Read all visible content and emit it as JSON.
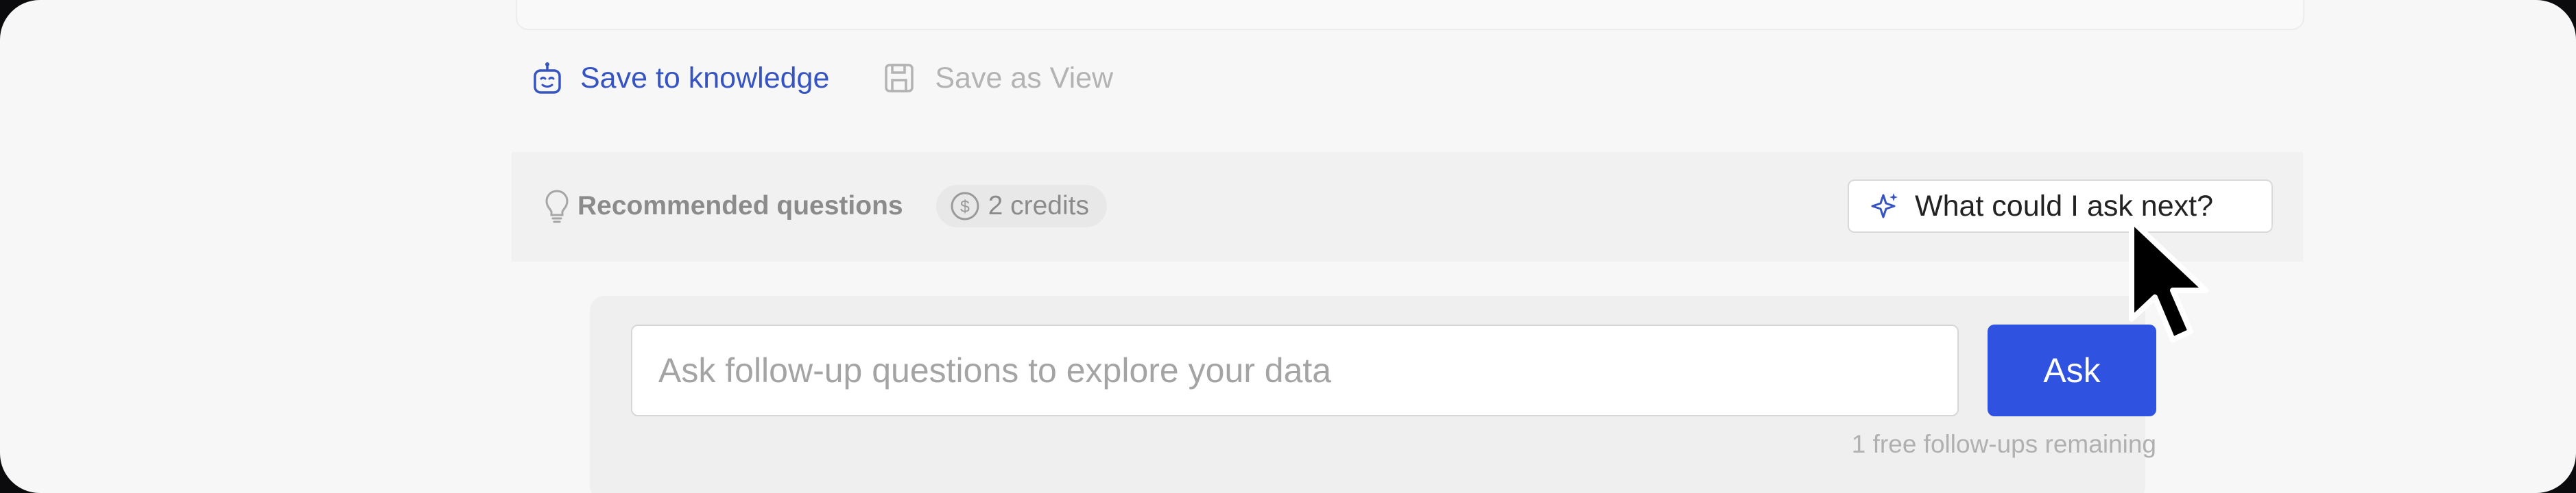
{
  "actions": {
    "save_to_knowledge": "Save to knowledge",
    "save_as_view": "Save as View"
  },
  "recommended": {
    "title": "Recommended questions",
    "credits": "2 credits",
    "ask_next_label": "What could I ask next?"
  },
  "followup": {
    "placeholder": "Ask follow-up questions to explore your data",
    "value": "",
    "ask_label": "Ask",
    "remaining": "1 free follow-ups remaining"
  },
  "colors": {
    "accent": "#2f52e0",
    "link": "#3653c2",
    "muted": "#8b8b8b"
  },
  "icons": {
    "knowledge": "robot-icon",
    "view": "save-disk-icon",
    "recommended": "lightbulb-icon",
    "credits": "dollar-coin-icon",
    "ask_next": "sparkle-icon",
    "cursor": "mouse-pointer-icon"
  }
}
